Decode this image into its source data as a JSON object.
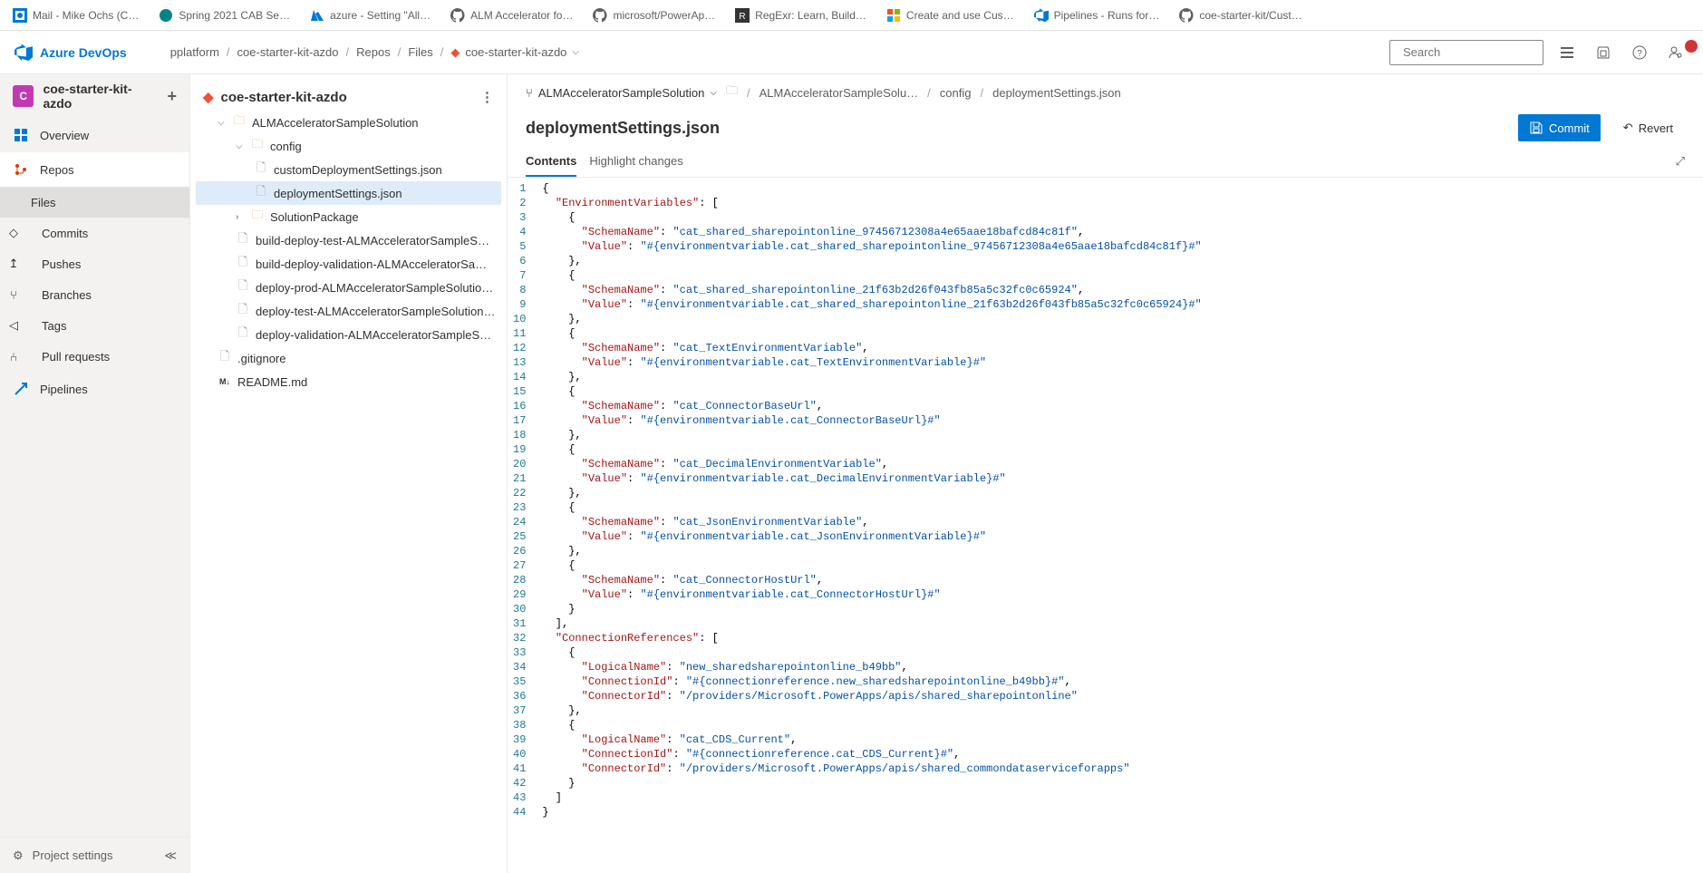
{
  "browser_tabs": [
    {
      "label": "Mail - Mike Ochs (C…",
      "icon": "outlook"
    },
    {
      "label": "Spring 2021 CAB Se…",
      "icon": "sp"
    },
    {
      "label": "azure - Setting \"All…",
      "icon": "azure"
    },
    {
      "label": "ALM Accelerator fo…",
      "icon": "gh"
    },
    {
      "label": "microsoft/PowerAp…",
      "icon": "gh"
    },
    {
      "label": "RegExr: Learn, Build…",
      "icon": "regex"
    },
    {
      "label": "Create and use Cus…",
      "icon": "ms"
    },
    {
      "label": "Pipelines - Runs for…",
      "icon": "ado"
    },
    {
      "label": "coe-starter-kit/Cust…",
      "icon": "gh"
    }
  ],
  "ado_brand": "Azure DevOps",
  "breadcrumb": {
    "org": "pplatform",
    "project": "coe-starter-kit-azdo",
    "section": "Repos",
    "sub": "Files",
    "repo": "coe-starter-kit-azdo"
  },
  "search_placeholder": "Search",
  "project": {
    "badge": "C",
    "name": "coe-starter-kit-azdo"
  },
  "nav": {
    "overview": "Overview",
    "repos": "Repos",
    "files": "Files",
    "commits": "Commits",
    "pushes": "Pushes",
    "branches": "Branches",
    "tags": "Tags",
    "pull_requests": "Pull requests",
    "pipelines": "Pipelines",
    "project_settings": "Project settings"
  },
  "tree": {
    "repo": "coe-starter-kit-azdo",
    "folder1": "ALMAcceleratorSampleSolution",
    "folder2": "config",
    "file_cds": "customDeploymentSettings.json",
    "file_ds": "deploymentSettings.json",
    "folder3": "SolutionPackage",
    "f_bdt": "build-deploy-test-ALMAcceleratorSampleSolutio…",
    "f_bdv": "build-deploy-validation-ALMAcceleratorSampleS…",
    "f_dp": "deploy-prod-ALMAcceleratorSampleSolution.yml",
    "f_dt": "deploy-test-ALMAcceleratorSampleSolution.yml",
    "f_dv": "deploy-validation-ALMAcceleratorSampleSolutio…",
    "f_gi": ".gitignore",
    "f_rm": "README.md"
  },
  "path": {
    "branch": "ALMAcceleratorSampleSolution",
    "p1": "ALMAcceleratorSampleSolu…",
    "p2": "config",
    "p3": "deploymentSettings.json"
  },
  "file_title": "deploymentSettings.json",
  "buttons": {
    "commit": "Commit",
    "revert": "Revert"
  },
  "tabs": {
    "contents": "Contents",
    "highlight": "Highlight changes"
  },
  "code_lines": [
    [
      {
        "t": "p",
        "v": "{"
      }
    ],
    [
      {
        "t": "p",
        "v": "  "
      },
      {
        "t": "k",
        "v": "\"EnvironmentVariables\""
      },
      {
        "t": "p",
        "v": ": ["
      }
    ],
    [
      {
        "t": "p",
        "v": "    {"
      }
    ],
    [
      {
        "t": "p",
        "v": "      "
      },
      {
        "t": "k",
        "v": "\"SchemaName\""
      },
      {
        "t": "p",
        "v": ": "
      },
      {
        "t": "s",
        "v": "\"cat_shared_sharepointonline_97456712308a4e65aae18bafcd84c81f\""
      },
      {
        "t": "p",
        "v": ","
      }
    ],
    [
      {
        "t": "p",
        "v": "      "
      },
      {
        "t": "k",
        "v": "\"Value\""
      },
      {
        "t": "p",
        "v": ": "
      },
      {
        "t": "s",
        "v": "\"#{environmentvariable.cat_shared_sharepointonline_97456712308a4e65aae18bafcd84c81f}#\""
      }
    ],
    [
      {
        "t": "p",
        "v": "    },"
      }
    ],
    [
      {
        "t": "p",
        "v": "    {"
      }
    ],
    [
      {
        "t": "p",
        "v": "      "
      },
      {
        "t": "k",
        "v": "\"SchemaName\""
      },
      {
        "t": "p",
        "v": ": "
      },
      {
        "t": "s",
        "v": "\"cat_shared_sharepointonline_21f63b2d26f043fb85a5c32fc0c65924\""
      },
      {
        "t": "p",
        "v": ","
      }
    ],
    [
      {
        "t": "p",
        "v": "      "
      },
      {
        "t": "k",
        "v": "\"Value\""
      },
      {
        "t": "p",
        "v": ": "
      },
      {
        "t": "s",
        "v": "\"#{environmentvariable.cat_shared_sharepointonline_21f63b2d26f043fb85a5c32fc0c65924}#\""
      }
    ],
    [
      {
        "t": "p",
        "v": "    },"
      }
    ],
    [
      {
        "t": "p",
        "v": "    {"
      }
    ],
    [
      {
        "t": "p",
        "v": "      "
      },
      {
        "t": "k",
        "v": "\"SchemaName\""
      },
      {
        "t": "p",
        "v": ": "
      },
      {
        "t": "s",
        "v": "\"cat_TextEnvironmentVariable\""
      },
      {
        "t": "p",
        "v": ","
      }
    ],
    [
      {
        "t": "p",
        "v": "      "
      },
      {
        "t": "k",
        "v": "\"Value\""
      },
      {
        "t": "p",
        "v": ": "
      },
      {
        "t": "s",
        "v": "\"#{environmentvariable.cat_TextEnvironmentVariable}#\""
      }
    ],
    [
      {
        "t": "p",
        "v": "    },"
      }
    ],
    [
      {
        "t": "p",
        "v": "    {"
      }
    ],
    [
      {
        "t": "p",
        "v": "      "
      },
      {
        "t": "k",
        "v": "\"SchemaName\""
      },
      {
        "t": "p",
        "v": ": "
      },
      {
        "t": "s",
        "v": "\"cat_ConnectorBaseUrl\""
      },
      {
        "t": "p",
        "v": ","
      }
    ],
    [
      {
        "t": "p",
        "v": "      "
      },
      {
        "t": "k",
        "v": "\"Value\""
      },
      {
        "t": "p",
        "v": ": "
      },
      {
        "t": "s",
        "v": "\"#{environmentvariable.cat_ConnectorBaseUrl}#\""
      }
    ],
    [
      {
        "t": "p",
        "v": "    },"
      }
    ],
    [
      {
        "t": "p",
        "v": "    {"
      }
    ],
    [
      {
        "t": "p",
        "v": "      "
      },
      {
        "t": "k",
        "v": "\"SchemaName\""
      },
      {
        "t": "p",
        "v": ": "
      },
      {
        "t": "s",
        "v": "\"cat_DecimalEnvironmentVariable\""
      },
      {
        "t": "p",
        "v": ","
      }
    ],
    [
      {
        "t": "p",
        "v": "      "
      },
      {
        "t": "k",
        "v": "\"Value\""
      },
      {
        "t": "p",
        "v": ": "
      },
      {
        "t": "s",
        "v": "\"#{environmentvariable.cat_DecimalEnvironmentVariable}#\""
      }
    ],
    [
      {
        "t": "p",
        "v": "    },"
      }
    ],
    [
      {
        "t": "p",
        "v": "    {"
      }
    ],
    [
      {
        "t": "p",
        "v": "      "
      },
      {
        "t": "k",
        "v": "\"SchemaName\""
      },
      {
        "t": "p",
        "v": ": "
      },
      {
        "t": "s",
        "v": "\"cat_JsonEnvironmentVariable\""
      },
      {
        "t": "p",
        "v": ","
      }
    ],
    [
      {
        "t": "p",
        "v": "      "
      },
      {
        "t": "k",
        "v": "\"Value\""
      },
      {
        "t": "p",
        "v": ": "
      },
      {
        "t": "s",
        "v": "\"#{environmentvariable.cat_JsonEnvironmentVariable}#\""
      }
    ],
    [
      {
        "t": "p",
        "v": "    },"
      }
    ],
    [
      {
        "t": "p",
        "v": "    {"
      }
    ],
    [
      {
        "t": "p",
        "v": "      "
      },
      {
        "t": "k",
        "v": "\"SchemaName\""
      },
      {
        "t": "p",
        "v": ": "
      },
      {
        "t": "s",
        "v": "\"cat_ConnectorHostUrl\""
      },
      {
        "t": "p",
        "v": ","
      }
    ],
    [
      {
        "t": "p",
        "v": "      "
      },
      {
        "t": "k",
        "v": "\"Value\""
      },
      {
        "t": "p",
        "v": ": "
      },
      {
        "t": "s",
        "v": "\"#{environmentvariable.cat_ConnectorHostUrl}#\""
      }
    ],
    [
      {
        "t": "p",
        "v": "    }"
      }
    ],
    [
      {
        "t": "p",
        "v": "  ],"
      }
    ],
    [
      {
        "t": "p",
        "v": "  "
      },
      {
        "t": "k",
        "v": "\"ConnectionReferences\""
      },
      {
        "t": "p",
        "v": ": ["
      }
    ],
    [
      {
        "t": "p",
        "v": "    {"
      }
    ],
    [
      {
        "t": "p",
        "v": "      "
      },
      {
        "t": "k",
        "v": "\"LogicalName\""
      },
      {
        "t": "p",
        "v": ": "
      },
      {
        "t": "s",
        "v": "\"new_sharedsharepointonline_b49bb\""
      },
      {
        "t": "p",
        "v": ","
      }
    ],
    [
      {
        "t": "p",
        "v": "      "
      },
      {
        "t": "k",
        "v": "\"ConnectionId\""
      },
      {
        "t": "p",
        "v": ": "
      },
      {
        "t": "s",
        "v": "\"#{connectionreference.new_sharedsharepointonline_b49bb}#\""
      },
      {
        "t": "p",
        "v": ","
      }
    ],
    [
      {
        "t": "p",
        "v": "      "
      },
      {
        "t": "k",
        "v": "\"ConnectorId\""
      },
      {
        "t": "p",
        "v": ": "
      },
      {
        "t": "s",
        "v": "\"/providers/Microsoft.PowerApps/apis/shared_sharepointonline\""
      }
    ],
    [
      {
        "t": "p",
        "v": "    },"
      }
    ],
    [
      {
        "t": "p",
        "v": "    {"
      }
    ],
    [
      {
        "t": "p",
        "v": "      "
      },
      {
        "t": "k",
        "v": "\"LogicalName\""
      },
      {
        "t": "p",
        "v": ": "
      },
      {
        "t": "s",
        "v": "\"cat_CDS_Current\""
      },
      {
        "t": "p",
        "v": ","
      }
    ],
    [
      {
        "t": "p",
        "v": "      "
      },
      {
        "t": "k",
        "v": "\"ConnectionId\""
      },
      {
        "t": "p",
        "v": ": "
      },
      {
        "t": "s",
        "v": "\"#{connectionreference.cat_CDS_Current}#\""
      },
      {
        "t": "p",
        "v": ","
      }
    ],
    [
      {
        "t": "p",
        "v": "      "
      },
      {
        "t": "k",
        "v": "\"ConnectorId\""
      },
      {
        "t": "p",
        "v": ": "
      },
      {
        "t": "s",
        "v": "\"/providers/Microsoft.PowerApps/apis/shared_commondataserviceforapps\""
      }
    ],
    [
      {
        "t": "p",
        "v": "    }"
      }
    ],
    [
      {
        "t": "p",
        "v": "  ]"
      }
    ],
    [
      {
        "t": "p",
        "v": "}"
      }
    ]
  ]
}
